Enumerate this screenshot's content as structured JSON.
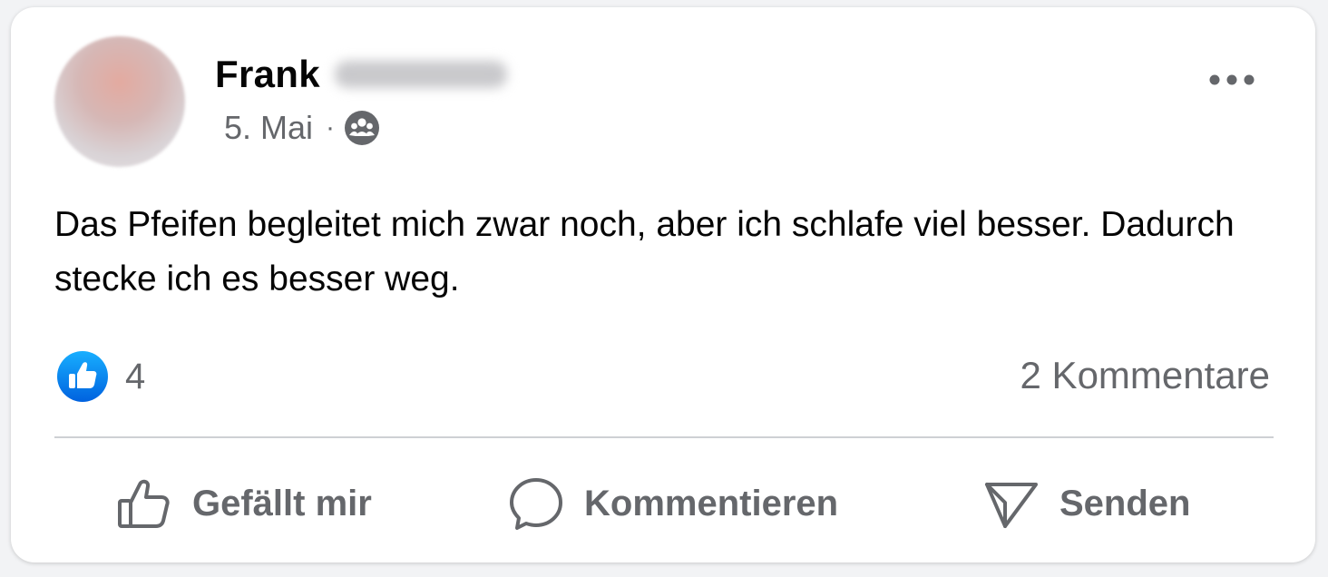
{
  "post": {
    "author_name": "Frank",
    "date": "5. Mai",
    "separator": "·",
    "audience_icon": "friends-icon",
    "text": "Das Pfeifen begleitet mich zwar noch, aber ich schlafe viel besser. Dadurch stecke ich es besser weg.",
    "like_count": "4",
    "comments_label": "2 Kommentare"
  },
  "actions": {
    "like_label": "Gefällt mir",
    "comment_label": "Kommentieren",
    "send_label": "Senden"
  },
  "colors": {
    "text_primary": "#050505",
    "text_secondary": "#65676b",
    "like_blue": "#1877f2",
    "divider": "#ced0d4"
  }
}
